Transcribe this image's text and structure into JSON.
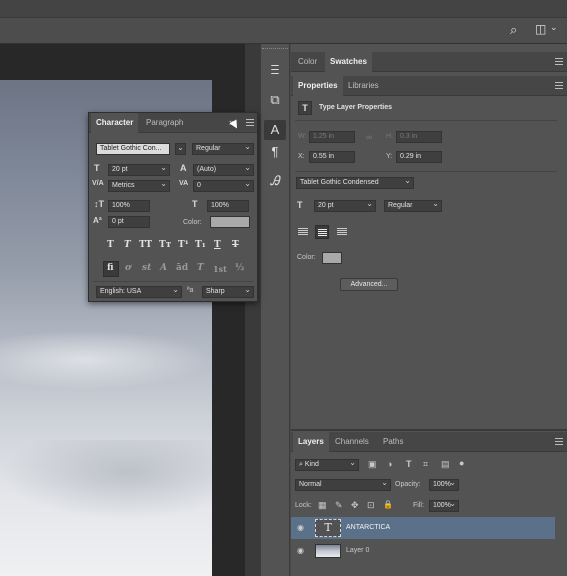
{
  "icons": {
    "search": "⌕",
    "workspace": "◫",
    "history": "Ⲷ",
    "properties": "⧉",
    "character": "A",
    "paragraph": "¶",
    "glyphs": "Ꭿ",
    "eye": "◉",
    "type": "T"
  },
  "character_panel": {
    "tabs": [
      "Character",
      "Paragraph"
    ],
    "font_family": "Tablet Gothic Con...",
    "font_style": "Regular",
    "font_size": "20 pt",
    "leading": "(Auto)",
    "kerning": "Metrics",
    "tracking": "0",
    "vertical_scale": "100%",
    "horizontal_scale": "100%",
    "baseline_shift": "0 pt",
    "color_label": "Color:",
    "style_buttons": [
      "T",
      "T",
      "TT",
      "Tт",
      "T¹",
      "T₁",
      "T",
      "T"
    ],
    "opentype_buttons": [
      "fi",
      "ơ",
      "st",
      "A",
      "ād",
      "T",
      "1st",
      "½"
    ],
    "language": "English: USA",
    "aa_icon": "ªa",
    "antialias": "Sharp"
  },
  "right_top_tabs": [
    "Color",
    "Swatches"
  ],
  "properties_panel": {
    "tabs": [
      "Properties",
      "Libraries"
    ],
    "title": "Type Layer Properties",
    "w_label": "W:",
    "w_value": "1.25 in",
    "link": "∞",
    "h_label": "H:",
    "h_value": "0.3 in",
    "x_label": "X:",
    "x_value": "0.55 in",
    "y_label": "Y:",
    "y_value": "0.29 in",
    "font_family": "Tablet Gothic Condensed",
    "font_size": "20 pt",
    "font_style": "Regular",
    "color_label": "Color:",
    "advanced_button": "Advanced..."
  },
  "layers_panel": {
    "tabs": [
      "Layers",
      "Channels",
      "Paths"
    ],
    "filter": "Kind",
    "filter_icons": [
      "▣",
      "◑",
      "T",
      "⌗",
      "▤",
      "●"
    ],
    "blend_mode": "Normal",
    "opacity_label": "Opacity:",
    "opacity": "100%",
    "lock_label": "Lock:",
    "lock_icons": [
      "▦",
      "✎",
      "✥",
      "⊡",
      "🔒"
    ],
    "fill_label": "Fill:",
    "fill": "100%",
    "layers": [
      {
        "name": "ANTARCTICA",
        "type": "text",
        "selected": true
      },
      {
        "name": "Layer 0",
        "type": "image",
        "selected": false
      }
    ]
  }
}
